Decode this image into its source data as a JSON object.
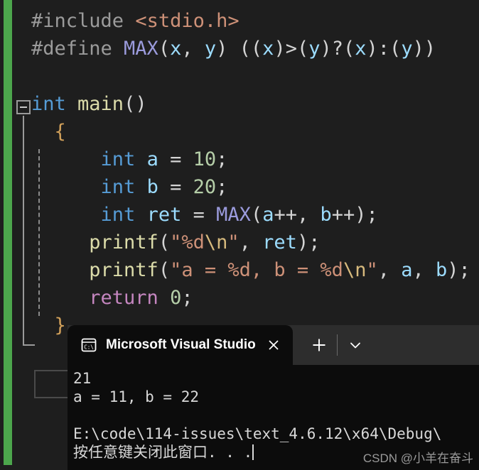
{
  "editor": {
    "background": "#1e1e1e",
    "change_bar_color": "#4CA64C",
    "collapse_icon": "collapse-minus-icon",
    "code_lines": [
      {
        "id": "line-include",
        "segments": [
          {
            "text": "#include ",
            "cls": "tok-pre"
          },
          {
            "text": "<stdio.h>",
            "cls": "tok-inc"
          }
        ]
      },
      {
        "id": "line-define",
        "segments": [
          {
            "text": "#define ",
            "cls": "tok-pre"
          },
          {
            "text": "MAX",
            "cls": "tok-macro"
          },
          {
            "text": "(",
            "cls": "tok-pun"
          },
          {
            "text": "x",
            "cls": "tok-var"
          },
          {
            "text": ", ",
            "cls": "tok-pun"
          },
          {
            "text": "y",
            "cls": "tok-var"
          },
          {
            "text": ") ((",
            "cls": "tok-pun"
          },
          {
            "text": "x",
            "cls": "tok-var"
          },
          {
            "text": ")>(",
            "cls": "tok-pun"
          },
          {
            "text": "y",
            "cls": "tok-var"
          },
          {
            "text": ")?(",
            "cls": "tok-pun"
          },
          {
            "text": "x",
            "cls": "tok-var"
          },
          {
            "text": "):(",
            "cls": "tok-pun"
          },
          {
            "text": "y",
            "cls": "tok-var"
          },
          {
            "text": "))",
            "cls": "tok-pun"
          }
        ]
      },
      {
        "id": "line-blank-1",
        "segments": [
          {
            "text": " ",
            "cls": "tok-pun"
          }
        ]
      },
      {
        "id": "line-main",
        "segments": [
          {
            "text": "int ",
            "cls": "tok-kw"
          },
          {
            "text": "main",
            "cls": "tok-fn"
          },
          {
            "text": "()",
            "cls": "tok-pun"
          }
        ]
      },
      {
        "id": "line-open-brace",
        "segments": [
          {
            "text": "  {",
            "cls": "tok-brace"
          }
        ]
      },
      {
        "id": "line-int-a",
        "segments": [
          {
            "text": "      ",
            "cls": "tok-pun"
          },
          {
            "text": "int",
            "cls": "tok-kw"
          },
          {
            "text": " ",
            "cls": "tok-pun"
          },
          {
            "text": "a",
            "cls": "tok-var"
          },
          {
            "text": " = ",
            "cls": "tok-pun"
          },
          {
            "text": "10",
            "cls": "tok-num"
          },
          {
            "text": ";",
            "cls": "tok-pun"
          }
        ]
      },
      {
        "id": "line-int-b",
        "segments": [
          {
            "text": "      ",
            "cls": "tok-pun"
          },
          {
            "text": "int",
            "cls": "tok-kw"
          },
          {
            "text": " ",
            "cls": "tok-pun"
          },
          {
            "text": "b",
            "cls": "tok-var"
          },
          {
            "text": " = ",
            "cls": "tok-pun"
          },
          {
            "text": "20",
            "cls": "tok-num"
          },
          {
            "text": ";",
            "cls": "tok-pun"
          }
        ]
      },
      {
        "id": "line-int-ret",
        "segments": [
          {
            "text": "      ",
            "cls": "tok-pun"
          },
          {
            "text": "int",
            "cls": "tok-kw"
          },
          {
            "text": " ",
            "cls": "tok-pun"
          },
          {
            "text": "ret",
            "cls": "tok-var"
          },
          {
            "text": " = ",
            "cls": "tok-pun"
          },
          {
            "text": "MAX",
            "cls": "tok-macro"
          },
          {
            "text": "(",
            "cls": "tok-pun"
          },
          {
            "text": "a",
            "cls": "tok-var"
          },
          {
            "text": "++, ",
            "cls": "tok-pun"
          },
          {
            "text": "b",
            "cls": "tok-var"
          },
          {
            "text": "++);",
            "cls": "tok-pun"
          }
        ]
      },
      {
        "id": "line-printf-ret",
        "segments": [
          {
            "text": "     ",
            "cls": "tok-pun"
          },
          {
            "text": "printf",
            "cls": "tok-fn"
          },
          {
            "text": "(",
            "cls": "tok-pun"
          },
          {
            "text": "\"%d",
            "cls": "tok-str"
          },
          {
            "text": "\\n",
            "cls": "tok-esc"
          },
          {
            "text": "\"",
            "cls": "tok-str"
          },
          {
            "text": ", ",
            "cls": "tok-pun"
          },
          {
            "text": "ret",
            "cls": "tok-var"
          },
          {
            "text": ");",
            "cls": "tok-pun"
          }
        ]
      },
      {
        "id": "line-printf-ab",
        "segments": [
          {
            "text": "     ",
            "cls": "tok-pun"
          },
          {
            "text": "printf",
            "cls": "tok-fn"
          },
          {
            "text": "(",
            "cls": "tok-pun"
          },
          {
            "text": "\"a = %d, b = %d",
            "cls": "tok-str"
          },
          {
            "text": "\\n",
            "cls": "tok-esc"
          },
          {
            "text": "\"",
            "cls": "tok-str"
          },
          {
            "text": ", ",
            "cls": "tok-pun"
          },
          {
            "text": "a",
            "cls": "tok-var"
          },
          {
            "text": ", ",
            "cls": "tok-pun"
          },
          {
            "text": "b",
            "cls": "tok-var"
          },
          {
            "text": ");",
            "cls": "tok-pun"
          }
        ]
      },
      {
        "id": "line-return",
        "segments": [
          {
            "text": "     ",
            "cls": "tok-pun"
          },
          {
            "text": "return",
            "cls": "tok-ret"
          },
          {
            "text": " ",
            "cls": "tok-pun"
          },
          {
            "text": "0",
            "cls": "tok-num"
          },
          {
            "text": ";",
            "cls": "tok-pun"
          }
        ]
      },
      {
        "id": "line-close-brace",
        "segments": [
          {
            "text": "  }",
            "cls": "tok-brace"
          }
        ]
      }
    ]
  },
  "terminal": {
    "background": "#0c0c0c",
    "tabbar_background": "#2d2d2d",
    "tab": {
      "icon": "console-cmd-icon",
      "title": "Microsoft Visual Studio",
      "close_icon": "close-icon"
    },
    "actions": {
      "new_tab_icon": "plus-icon",
      "dropdown_icon": "chevron-down-icon"
    },
    "output_lines": [
      "21",
      "a = 11, b = 22",
      "",
      "E:\\code\\114-issues\\text_4.6.12\\x64\\Debug\\",
      "按任意键关闭此窗口. . ."
    ]
  },
  "watermark": {
    "text": "CSDN @小羊在奋斗"
  }
}
